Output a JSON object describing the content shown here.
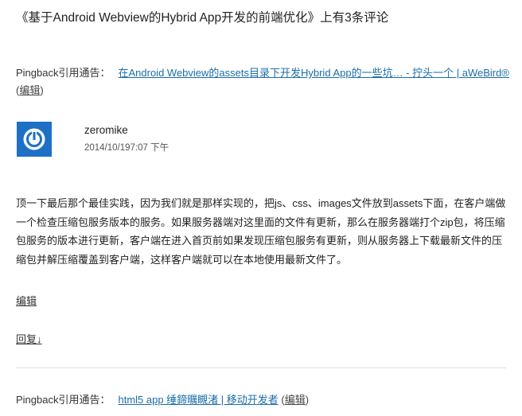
{
  "comments_title": "《基于Android Webview的Hybrid App开发的前端优化》上有3条评论",
  "pingbacks": [
    {
      "prefix": "Pingback引用通告：",
      "link_text": "在Android Webview的assets目录下开发Hybrid App的一些坑… - 拧头一个 | aWeBird®",
      "edit_label": "编辑"
    },
    {
      "prefix": "Pingback引用通告：",
      "link_text": "html5 app 缍鍗曞瞡渚 | 移动开发者",
      "edit_label": "编辑"
    }
  ],
  "comment": {
    "author": "zeromike",
    "date": "2014/10/197:07 下午",
    "avatar_icon": "power-logo-icon",
    "avatar_color": "#1e6fc6",
    "body": "顶一下最后那个最佳实践，因为我们就是那样实现的，把js、css、images文件放到assets下面，在客户端做一个检查压缩包服务版本的服务。如果服务器端对这里面的文件有更新，那么在服务器端打个zip包，将压缩包服务的版本进行更新，客户端在进入首页前如果发现压缩包服务有更新，则从服务器上下载最新文件的压缩包并解压缩覆盖到客户端，这样客户端就可以在本地使用最新文件了。",
    "edit_label": "编辑",
    "reply_label": "回复",
    "reply_arrow": "↓"
  },
  "link_color": "#1b6ea8"
}
